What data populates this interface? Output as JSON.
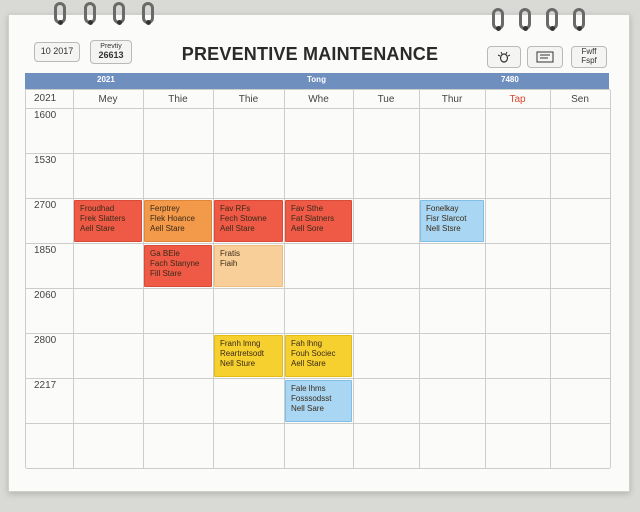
{
  "header": {
    "title": "PREVENTIVE MAINTENANCE",
    "left_button_1": "10 2017",
    "left_button_2_top": "Prevtiy",
    "left_button_2_bottom": "26613",
    "right_button_3": "Fwff\nFspf"
  },
  "bar": {
    "labels": [
      "2021",
      "Tong",
      "7480"
    ]
  },
  "grid": {
    "corner": "2021",
    "days": [
      {
        "label": "Mey",
        "color": "#444444"
      },
      {
        "label": "Thie",
        "color": "#444444"
      },
      {
        "label": "Thie",
        "color": "#444444"
      },
      {
        "label": "Whe",
        "color": "#444444"
      },
      {
        "label": "Tue",
        "color": "#444444"
      },
      {
        "label": "Thur",
        "color": "#444444"
      },
      {
        "label": "Tap",
        "color": "#d9472f"
      },
      {
        "label": "Sen",
        "color": "#444444"
      }
    ],
    "times": [
      "1600",
      "1530",
      "2700",
      "1850",
      "2060",
      "2800",
      "2217"
    ]
  },
  "events": [
    {
      "style": "red",
      "lines": [
        "Froudhad",
        "Frek Slatters",
        "Aell Stare"
      ]
    },
    {
      "style": "orange",
      "lines": [
        "Ferptrey",
        "Flek Hoance",
        "Aell Stare"
      ]
    },
    {
      "style": "red",
      "lines": [
        "Fav RFs",
        "Fech Stowne",
        "Aell Stare"
      ]
    },
    {
      "style": "red",
      "lines": [
        "Fav Sthe",
        "Fat Slatners",
        "Aell Sore"
      ]
    },
    {
      "style": "blue",
      "lines": [
        "Fonelkay",
        "Fisr Slarcot",
        "Nell Stsre"
      ]
    },
    {
      "style": "red",
      "lines": [
        "Ga BEle",
        "Fach Stanyne",
        "Fill Stare"
      ]
    },
    {
      "style": "peach",
      "lines": [
        "Fratis",
        "Fiaih"
      ]
    },
    {
      "style": "yellow",
      "lines": [
        "Franh lmng",
        "Reartretsodt",
        "Nell Sture"
      ]
    },
    {
      "style": "yellow",
      "lines": [
        "Fah lhng",
        "Fouh Sociec",
        "Aell Stare"
      ]
    },
    {
      "style": "blue",
      "lines": [
        "Fale lhms",
        "Fosssodsst",
        "Nell Sare"
      ]
    }
  ],
  "icons": {
    "bug": "bug-icon",
    "list": "list-icon"
  },
  "colors": {
    "bar": "#6f8fbf",
    "red": "#ee5a45",
    "orange": "#f39a4a",
    "peach": "#f8cf98",
    "yellow": "#f6d02e",
    "blue": "#a9d7f3",
    "weekend_header": "#d9472f"
  }
}
